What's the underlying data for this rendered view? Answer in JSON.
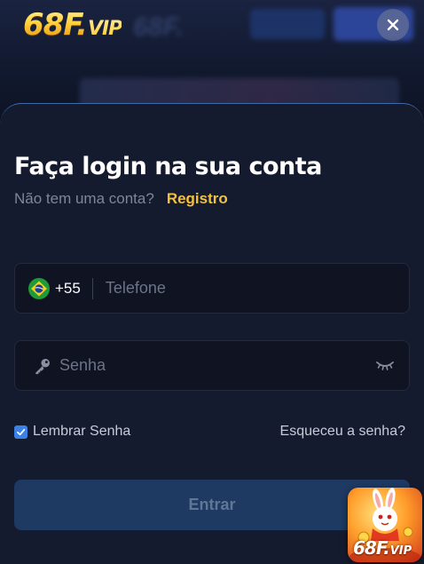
{
  "brand": {
    "logo_main": "68F.",
    "logo_vip": "VIP"
  },
  "login": {
    "title": "Faça login na sua conta",
    "no_account_text": "Não tem uma conta?",
    "register_link": "Registro",
    "phone": {
      "country_code": "+55",
      "country_flag": "brazil-flag-icon",
      "placeholder": "Telefone",
      "value": ""
    },
    "password": {
      "placeholder": "Senha",
      "value": ""
    },
    "remember": {
      "label": "Lembrar Senha",
      "checked": true
    },
    "forgot_link": "Esqueceu a senha?",
    "submit_label": "Entrar"
  },
  "promo": {
    "text_main": "68F.",
    "text_vip": "VIP"
  },
  "icons": [
    "close-icon",
    "brazil-flag-icon",
    "key-icon",
    "eye-closed-icon",
    "check-icon"
  ],
  "colors": {
    "accent_gold": "#f4c13d",
    "sheet_bg": "#151b2e",
    "input_bg": "#0f1322",
    "submit_bg": "#1e3a62",
    "checkbox": "#3b82e6"
  }
}
